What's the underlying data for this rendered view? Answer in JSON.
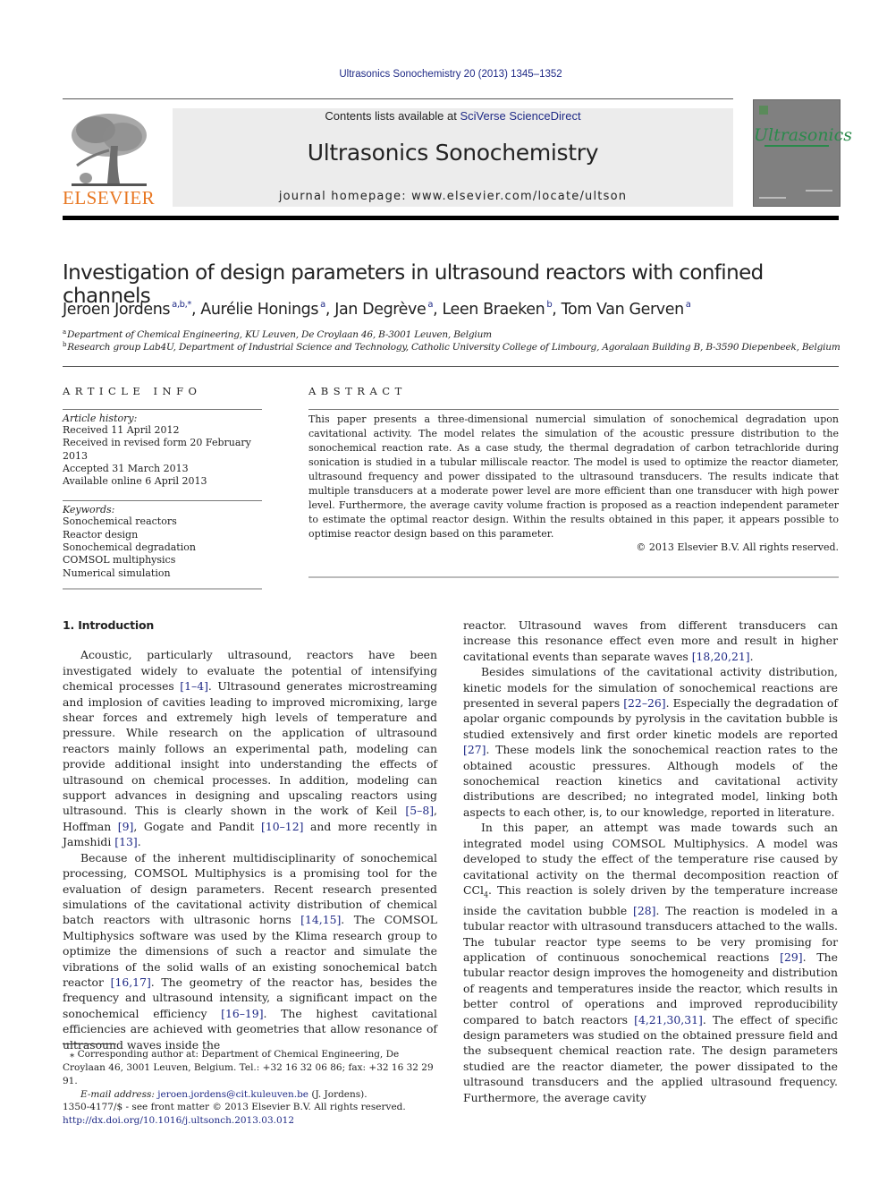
{
  "header": {
    "running_head": "Ultrasonics Sonochemistry 20 (2013) 1345–1352",
    "contents_prefix": "Contents lists available at ",
    "contents_link": "SciVerse ScienceDirect",
    "journal_name": "Ultrasonics Sonochemistry",
    "homepage_prefix": "journal homepage: ",
    "homepage_url": "www.elsevier.com/locate/ultson",
    "publisher": "ELSEVIER",
    "cover_title": "Ultrasonics",
    "colors": {
      "link": "#1f2a86",
      "elsevier_orange": "#e87722",
      "band": "#ececec",
      "cover_bg": "#808080",
      "cover_title": "#2a8a4b"
    }
  },
  "article": {
    "title": "Investigation of design parameters in ultrasound reactors with confined channels",
    "authors": [
      {
        "name": "Jeroen Jordens",
        "sup": "a,b,*"
      },
      {
        "name": "Aurélie Honings",
        "sup": "a"
      },
      {
        "name": "Jan Degrève",
        "sup": "a"
      },
      {
        "name": "Leen Braeken",
        "sup": "b"
      },
      {
        "name": "Tom Van Gerven",
        "sup": "a"
      }
    ],
    "affiliations": [
      {
        "mark": "a",
        "text": "Department of Chemical Engineering, KU Leuven, De Croylaan 46, B-3001 Leuven, Belgium"
      },
      {
        "mark": "b",
        "text": "Research group Lab4U, Department of Industrial Science and Technology, Catholic University College of Limbourg, Agoralaan Building B, B-3590 Diepenbeek, Belgium"
      }
    ]
  },
  "article_info": {
    "heading": "ARTICLE INFO",
    "history_label": "Article history:",
    "history": [
      "Received 11 April 2012",
      "Received in revised form 20 February 2013",
      "Accepted 31 March 2013",
      "Available online 6 April 2013"
    ],
    "keywords_label": "Keywords:",
    "keywords": [
      "Sonochemical reactors",
      "Reactor design",
      "Sonochemical degradation",
      "COMSOL multiphysics",
      "Numerical simulation"
    ]
  },
  "abstract": {
    "heading": "ABSTRACT",
    "text": "This paper presents a three-dimensional numercial simulation of sonochemical degradation upon cavitational activity. The model relates the simulation of the acoustic pressure distribution to the sonochemical reaction rate. As a case study, the thermal degradation of carbon tetrachloride during sonication is studied in a tubular milliscale reactor. The model is used to optimize the reactor diameter, ultrasound frequency and power dissipated to the ultrasound transducers. The results indicate that multiple transducers at a moderate power level are more efficient than one transducer with high power level. Furthermore, the average cavity volume fraction is proposed as a reaction independent parameter to estimate the optimal reactor design. Within the results obtained in this paper, it appears possible to optimise reactor design based on this parameter.",
    "copyright": "© 2013 Elsevier B.V. All rights reserved."
  },
  "intro": {
    "heading": "1. Introduction",
    "p1": [
      "Acoustic, particularly ultrasound, reactors have been investigated widely to evaluate the potential of intensifying chemical processes ",
      {
        "ref": "[1–4]"
      },
      ". Ultrasound generates microstreaming and implosion of cavities leading to improved micromixing, large shear forces and extremely high levels of temperature and pressure. While research on the application of ultrasound reactors mainly follows an experimental path, modeling can provide additional insight into understanding the effects of ultrasound on chemical processes. In addition, modeling can support advances in designing and upscaling reactors using ultrasound. This is clearly shown in the work of Keil ",
      {
        "ref": "[5–8]"
      },
      ", Hoffman ",
      {
        "ref": "[9]"
      },
      ", Gogate and Pandit ",
      {
        "ref": "[10–12]"
      },
      " and more recently in Jamshidi ",
      {
        "ref": "[13]"
      },
      "."
    ],
    "p2": [
      "Because of the inherent multidisciplinarity of sonochemical processing, COMSOL Multiphysics is a promising tool for the evaluation of design parameters. Recent research presented simulations of the cavitational activity distribution of chemical batch reactors with ultrasonic horns ",
      {
        "ref": "[14,15]"
      },
      ". The COMSOL Multiphysics software was used by the Klima research group to optimize the dimensions of such a reactor and simulate the vibrations of the solid walls of an existing sonochemical batch reactor ",
      {
        "ref": "[16,17]"
      },
      ". The geometry of the reactor has, besides the frequency and ultrasound intensity, a significant impact on the sonochemical efficiency ",
      {
        "ref": "[16–19]"
      },
      ". The highest cavitational efficiencies are achieved with geometries that allow resonance of ultrasound waves inside the"
    ],
    "p3": [
      "reactor. Ultrasound waves from different transducers can increase this resonance effect even more and result in higher cavitational events than separate waves ",
      {
        "ref": "[18,20,21]"
      },
      "."
    ],
    "p4": [
      "Besides simulations of the cavitational activity distribution, kinetic models for the simulation of sonochemical reactions are presented in several papers ",
      {
        "ref": "[22–26]"
      },
      ". Especially the degradation of apolar organic compounds by pyrolysis in the cavitation bubble is studied extensively and first order kinetic models are reported ",
      {
        "ref": "[27]"
      },
      ". These models link the sonochemical reaction rates to the obtained acoustic pressures. Although models of the sonochemical reaction kinetics and cavitational activity distributions are described; no integrated model, linking both aspects to each other, is, to our knowledge, reported in literature."
    ],
    "p5": [
      "In this paper, an attempt was made towards such an integrated model using COMSOL Multiphysics. A model was developed to study the effect of the temperature rise caused by cavitational activity on the thermal decomposition reaction of CCl",
      {
        "sub": "4"
      },
      ". This reaction is solely driven by the temperature increase inside the cavitation bubble ",
      {
        "ref": "[28]"
      },
      ". The reaction is modeled in a tubular reactor with ultrasound transducers attached to the walls. The tubular reactor type seems to be very promising for application of continuous sonochemical reactions ",
      {
        "ref": "[29]"
      },
      ". The tubular reactor design improves the homogeneity and distribution of reagents and temperatures inside the reactor, which results in better control of operations and improved reproducibility compared to batch reactors ",
      {
        "ref": "[4,21,30,31]"
      },
      ". The effect of specific design parameters was studied on the obtained pressure field and the subsequent chemical reaction rate. The design parameters studied are the reactor diameter, the power dissipated to the ultrasound transducers and the applied ultrasound frequency. Furthermore, the average cavity"
    ]
  },
  "footnote": {
    "star": "⁎",
    "corresponding": " Corresponding author at: Department of Chemical Engineering, De Croylaan 46, 3001 Leuven, Belgium. Tel.: +32 16 32 06 86; fax: +32 16 32 29 91.",
    "email_label": "E-mail address: ",
    "email": "jeroen.jordens@cit.kuleuven.be",
    "email_suffix": " (J. Jordens)."
  },
  "front_matter": {
    "issn_line": "1350-4177/$ - see front matter © 2013 Elsevier B.V. All rights reserved.",
    "doi": "http://dx.doi.org/10.1016/j.ultsonch.2013.03.012"
  }
}
